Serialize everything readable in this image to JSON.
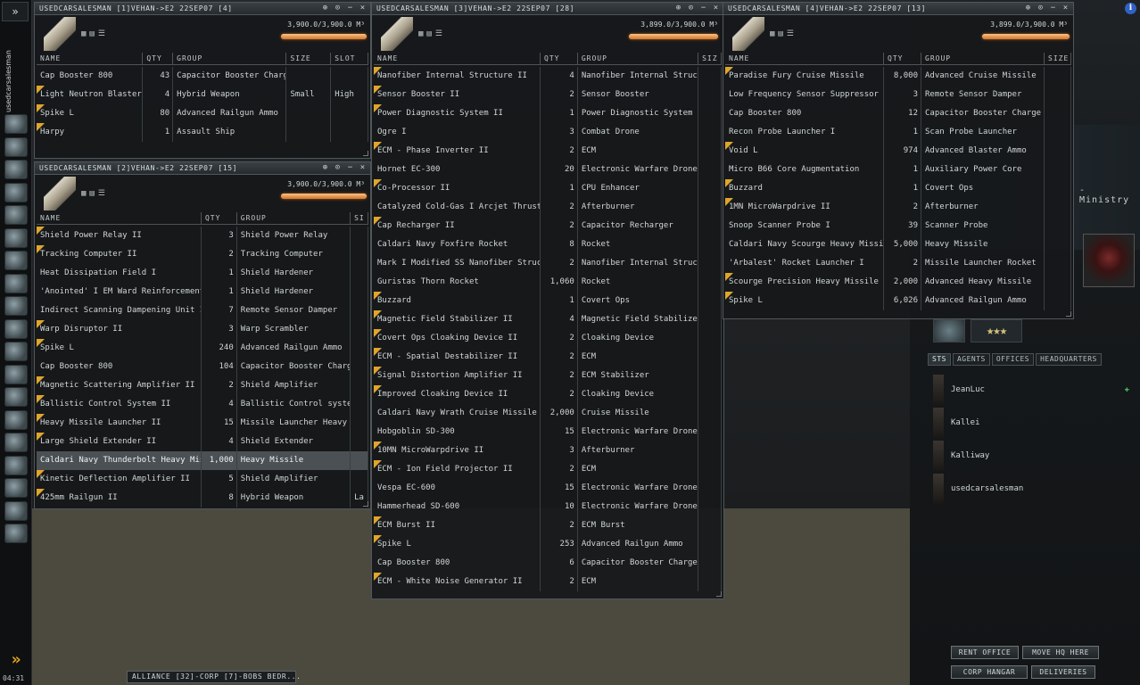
{
  "sidebar": {
    "collapse_label": "»",
    "character_name": "usedcarsalesman",
    "icons": [
      "character-sheet-icon",
      "mail-icon",
      "notepad-icon",
      "people-places-icon",
      "map-icon",
      "market-icon",
      "fitting-icon",
      "starmap-icon",
      "ships-icon",
      "assets-icon",
      "science-icon",
      "journal-icon",
      "wallet-icon",
      "settings-icon",
      "help-icon",
      "corporation-icon",
      "portrait-icon",
      "drones-icon",
      "jumpclone-icon"
    ],
    "expand_label": "»",
    "time": "04:31"
  },
  "alliance_bar": {
    "label": "ALLIANCE [32]-CORP [7]-BOBS BEDR..."
  },
  "windows": [
    {
      "title": "USEDCARSALESMAN [1]VEHAN->E2 22SEP07 [4]",
      "capacity": "3,900.0/3,900.0 M³",
      "fill": 1.0,
      "columns": [
        "NAME",
        "QTY",
        "GROUP",
        "SIZE",
        "SLOT"
      ],
      "rows": [
        {
          "name": "Cap Booster 800",
          "qty": "43",
          "group": "Capacitor Booster Charge",
          "size": "",
          "slot": "",
          "tech2": false
        },
        {
          "name": "Light Neutron Blaster II",
          "qty": "4",
          "group": "Hybrid Weapon",
          "size": "Small",
          "slot": "High",
          "tech2": true
        },
        {
          "name": "Spike L",
          "qty": "80",
          "group": "Advanced Railgun Ammo",
          "size": "",
          "slot": "",
          "tech2": true
        },
        {
          "name": "Harpy",
          "qty": "1",
          "group": "Assault Ship",
          "size": "",
          "slot": "",
          "tech2": true
        }
      ]
    },
    {
      "title": "USEDCARSALESMAN [2]VEHAN->E2 22SEP07 [15]",
      "capacity": "3,900.0/3,900.0 M³",
      "fill": 1.0,
      "columns": [
        "NAME",
        "QTY",
        "GROUP",
        "SI"
      ],
      "rows": [
        {
          "name": "Shield Power Relay II",
          "qty": "3",
          "group": "Shield Power Relay",
          "tech2": true
        },
        {
          "name": "Tracking Computer II",
          "qty": "2",
          "group": "Tracking Computer",
          "tech2": true
        },
        {
          "name": "Heat Dissipation Field I",
          "qty": "1",
          "group": "Shield Hardener",
          "tech2": false
        },
        {
          "name": "'Anointed' I EM Ward Reinforcement",
          "qty": "1",
          "group": "Shield Hardener",
          "tech2": false
        },
        {
          "name": "Indirect Scanning Dampening Unit I",
          "qty": "7",
          "group": "Remote Sensor Damper",
          "tech2": false
        },
        {
          "name": "Warp Disruptor II",
          "qty": "3",
          "group": "Warp Scrambler",
          "tech2": true
        },
        {
          "name": "Spike L",
          "qty": "240",
          "group": "Advanced Railgun Ammo",
          "tech2": true
        },
        {
          "name": "Cap Booster 800",
          "qty": "104",
          "group": "Capacitor Booster Charge",
          "tech2": false
        },
        {
          "name": "Magnetic Scattering Amplifier II",
          "qty": "2",
          "group": "Shield Amplifier",
          "tech2": true
        },
        {
          "name": "Ballistic Control System II",
          "qty": "4",
          "group": "Ballistic Control system",
          "tech2": true
        },
        {
          "name": "Heavy Missile Launcher II",
          "qty": "15",
          "group": "Missile Launcher Heavy",
          "tech2": true
        },
        {
          "name": "Large Shield Extender II",
          "qty": "4",
          "group": "Shield Extender",
          "tech2": true
        },
        {
          "name": "Caldari Navy Thunderbolt Heavy Missile",
          "qty": "1,000",
          "group": "Heavy Missile",
          "tech2": false,
          "selected": true
        },
        {
          "name": "Kinetic Deflection Amplifier II",
          "qty": "5",
          "group": "Shield Amplifier",
          "tech2": true
        },
        {
          "name": "425mm Railgun II",
          "qty": "8",
          "group": "Hybrid Weapon",
          "size": "La",
          "tech2": true
        }
      ]
    },
    {
      "title": "USEDCARSALESMAN [3]VEHAN->E2 22SEP07 [28]",
      "capacity": "3,899.0/3,900.0 M³",
      "fill": 0.9997,
      "columns": [
        "NAME",
        "QTY",
        "GROUP",
        "SIZ"
      ],
      "rows": [
        {
          "name": "Nanofiber Internal Structure II",
          "qty": "4",
          "group": "Nanofiber Internal Structure",
          "tech2": true
        },
        {
          "name": "Sensor Booster II",
          "qty": "2",
          "group": "Sensor Booster",
          "tech2": true
        },
        {
          "name": "Power Diagnostic System II",
          "qty": "1",
          "group": "Power Diagnostic System",
          "tech2": true
        },
        {
          "name": "Ogre I",
          "qty": "3",
          "group": "Combat Drone",
          "tech2": false
        },
        {
          "name": "ECM - Phase Inverter II",
          "qty": "2",
          "group": "ECM",
          "tech2": true
        },
        {
          "name": "Hornet EC-300",
          "qty": "20",
          "group": "Electronic Warfare Drone",
          "tech2": false
        },
        {
          "name": "Co-Processor II",
          "qty": "1",
          "group": "CPU Enhancer",
          "tech2": true
        },
        {
          "name": "Catalyzed Cold-Gas I Arcjet Thrusters",
          "qty": "2",
          "group": "Afterburner",
          "tech2": false
        },
        {
          "name": "Cap Recharger II",
          "qty": "2",
          "group": "Capacitor Recharger",
          "tech2": true
        },
        {
          "name": "Caldari Navy Foxfire Rocket",
          "qty": "8",
          "group": "Rocket",
          "tech2": false
        },
        {
          "name": "Mark I Modified SS Nanofiber Structure",
          "qty": "2",
          "group": "Nanofiber Internal Structure",
          "tech2": false
        },
        {
          "name": "Guristas Thorn Rocket",
          "qty": "1,060",
          "group": "Rocket",
          "tech2": false
        },
        {
          "name": "Buzzard",
          "qty": "1",
          "group": "Covert Ops",
          "tech2": true
        },
        {
          "name": "Magnetic Field Stabilizer II",
          "qty": "4",
          "group": "Magnetic Field Stabilizer",
          "tech2": true
        },
        {
          "name": "Covert Ops Cloaking Device II",
          "qty": "2",
          "group": "Cloaking Device",
          "tech2": true
        },
        {
          "name": "ECM - Spatial Destabilizer II",
          "qty": "2",
          "group": "ECM",
          "tech2": true
        },
        {
          "name": "Signal Distortion Amplifier II",
          "qty": "2",
          "group": "ECM Stabilizer",
          "tech2": true
        },
        {
          "name": "Improved Cloaking Device II",
          "qty": "2",
          "group": "Cloaking Device",
          "tech2": true
        },
        {
          "name": "Caldari Navy Wrath Cruise Missile",
          "qty": "2,000",
          "group": "Cruise Missile",
          "tech2": false
        },
        {
          "name": "Hobgoblin SD-300",
          "qty": "15",
          "group": "Electronic Warfare Drone",
          "tech2": false
        },
        {
          "name": "10MN MicroWarpdrive II",
          "qty": "3",
          "group": "Afterburner",
          "tech2": true
        },
        {
          "name": "ECM - Ion Field Projector II",
          "qty": "2",
          "group": "ECM",
          "tech2": true
        },
        {
          "name": "Vespa EC-600",
          "qty": "15",
          "group": "Electronic Warfare Drone",
          "tech2": false
        },
        {
          "name": "Hammerhead SD-600",
          "qty": "10",
          "group": "Electronic Warfare Drone",
          "tech2": false
        },
        {
          "name": "ECM Burst II",
          "qty": "2",
          "group": "ECM Burst",
          "tech2": true
        },
        {
          "name": "Spike L",
          "qty": "253",
          "group": "Advanced Railgun Ammo",
          "tech2": true
        },
        {
          "name": "Cap Booster 800",
          "qty": "6",
          "group": "Capacitor Booster Charge",
          "tech2": false
        },
        {
          "name": "ECM - White Noise Generator II",
          "qty": "2",
          "group": "ECM",
          "tech2": true
        }
      ]
    },
    {
      "title": "USEDCARSALESMAN [4]VEHAN->E2 22SEP07 [13]",
      "capacity": "3,899.0/3,900.0 M³",
      "fill": 0.9997,
      "columns": [
        "NAME",
        "QTY",
        "GROUP",
        "SIZE"
      ],
      "rows": [
        {
          "name": "Paradise Fury Cruise Missile",
          "qty": "8,000",
          "group": "Advanced Cruise Missile",
          "tech2": true
        },
        {
          "name": "Low Frequency Sensor Suppressor I",
          "qty": "3",
          "group": "Remote Sensor Damper",
          "tech2": false
        },
        {
          "name": "Cap Booster 800",
          "qty": "12",
          "group": "Capacitor Booster Charge",
          "tech2": false
        },
        {
          "name": "Recon Probe Launcher I",
          "qty": "1",
          "group": "Scan Probe Launcher",
          "tech2": false
        },
        {
          "name": "Void L",
          "qty": "974",
          "group": "Advanced Blaster Ammo",
          "tech2": true
        },
        {
          "name": "Micro B66 Core Augmentation",
          "qty": "1",
          "group": "Auxiliary Power Core",
          "tech2": false
        },
        {
          "name": "Buzzard",
          "qty": "1",
          "group": "Covert Ops",
          "tech2": true
        },
        {
          "name": "1MN MicroWarpdrive II",
          "qty": "2",
          "group": "Afterburner",
          "tech2": true
        },
        {
          "name": "Snoop Scanner Probe I",
          "qty": "39",
          "group": "Scanner Probe",
          "tech2": false
        },
        {
          "name": "Caldari Navy Scourge Heavy Missile",
          "qty": "5,000",
          "group": "Heavy Missile",
          "tech2": false
        },
        {
          "name": "'Arbalest' Rocket Launcher I",
          "qty": "2",
          "group": "Missile Launcher Rocket",
          "tech2": false
        },
        {
          "name": "Scourge Precision Heavy Missile",
          "qty": "2,000",
          "group": "Advanced Heavy Missile",
          "tech2": true
        },
        {
          "name": "Spike L",
          "qty": "6,026",
          "group": "Advanced Railgun Ammo",
          "tech2": true
        }
      ]
    }
  ],
  "right_panel": {
    "title_fragment": "- Ministry",
    "tabs": [
      "STS",
      "AGENTS",
      "OFFICES",
      "HEADQUARTERS"
    ],
    "members": [
      {
        "name": "JeanLuc",
        "online": true
      },
      {
        "name": "Kallei",
        "online": false
      },
      {
        "name": "Kalliway",
        "online": false
      },
      {
        "name": "usedcarsalesman",
        "online": false
      }
    ],
    "buttons": {
      "rent_office": "RENT OFFICE",
      "move_hq": "MOVE HQ HERE",
      "corp_hangar": "CORP HANGAR",
      "deliveries": "DELIVERIES"
    },
    "stars": "★★★"
  }
}
